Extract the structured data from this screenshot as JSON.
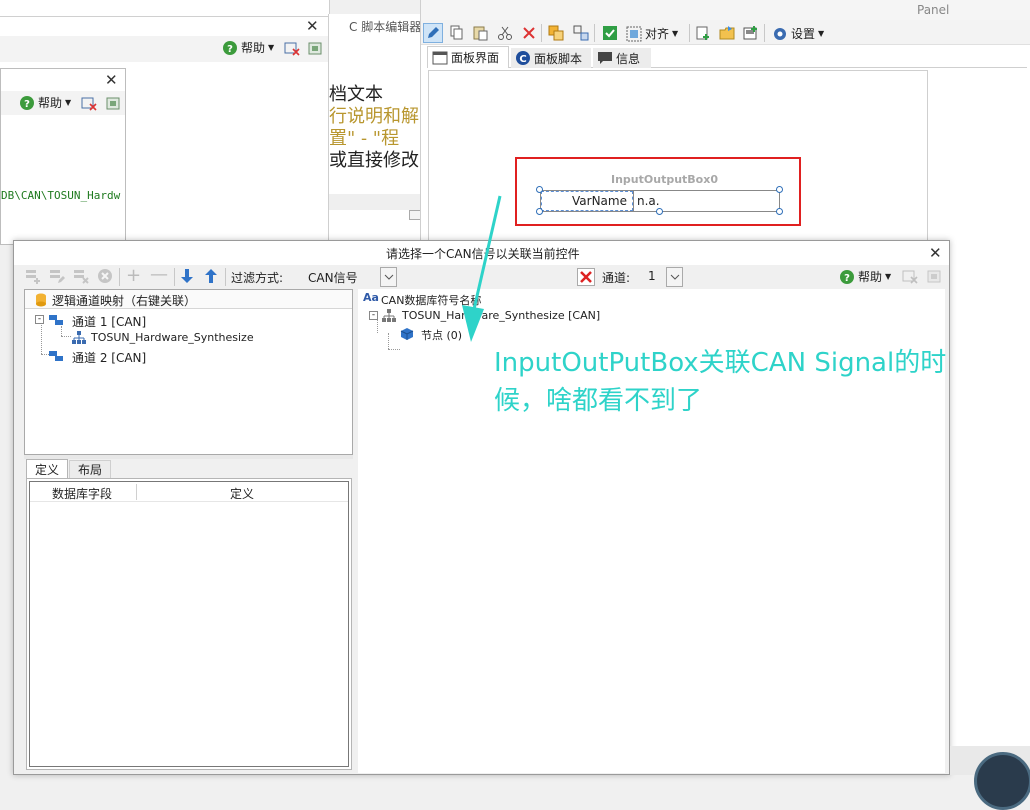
{
  "bg_window_a": {
    "help_label": "帮助",
    "close_glyph": "✕"
  },
  "bg_window_b": {
    "help_label": "帮助",
    "close_glyph": "✕",
    "path_text": "DB\\CAN\\TOSUN_Hardw"
  },
  "script_editor": {
    "title": "C 脚本编辑器",
    "lines": [
      "档文本",
      "行说明和解",
      "置\" - \"程",
      "或直接修改"
    ]
  },
  "panel": {
    "title": "Panel",
    "align_label": "对齐",
    "settings_label": "设置",
    "tabs": [
      {
        "label": "面板界面"
      },
      {
        "label": "面板脚本"
      },
      {
        "label": "信息"
      }
    ],
    "widget": {
      "title": "InputOutputBox0",
      "var_label": "VarName",
      "value": "n.a."
    }
  },
  "dialog": {
    "title": "请选择一个CAN信号以关联当前控件",
    "close_glyph": "✕",
    "filter_label": "过滤方式:",
    "filter_value": "CAN信号",
    "channel_label": "通道:",
    "channel_value": "1",
    "help_label": "帮助",
    "left_tree": {
      "header": "逻辑通道映射（右键关联）",
      "items": [
        {
          "label": "通道 1 [CAN]"
        },
        {
          "label": "TOSUN_Hardware_Synthesize"
        },
        {
          "label": "通道 2 [CAN]"
        }
      ]
    },
    "tabs": [
      {
        "label": "定义"
      },
      {
        "label": "布局"
      }
    ],
    "columns": [
      {
        "label": "数据库字段"
      },
      {
        "label": "定义"
      }
    ],
    "right_tree": {
      "header_prefix": "Aa",
      "header": "CAN数据库符号名称",
      "items": [
        {
          "label": "TOSUN_Hardware_Synthesize [CAN]"
        },
        {
          "label": "节点 (0)"
        }
      ]
    }
  },
  "annotation": {
    "line1": "InputOutPutBox关联CAN Signal的时",
    "line2": "候，啥都看不到了",
    "color": "#2ed3c9",
    "highlight_color": "#e02020"
  }
}
